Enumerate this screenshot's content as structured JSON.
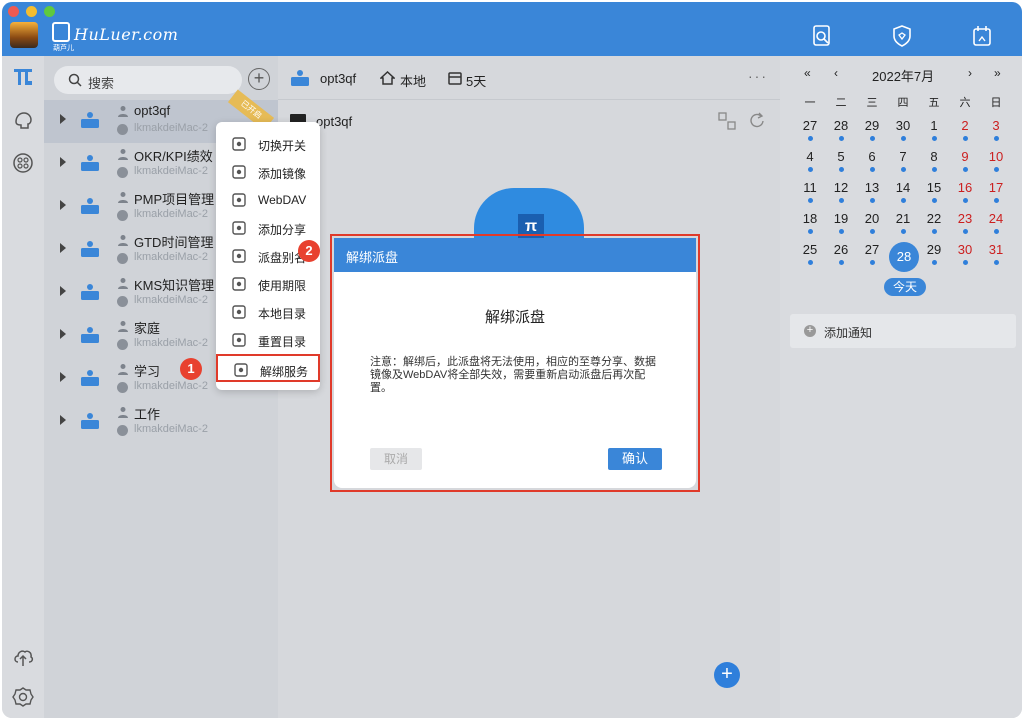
{
  "brand": {
    "logo_text": "HuLuer.com",
    "logo_sub": "葫芦儿"
  },
  "colors": {
    "accent": "#3a86d8",
    "highlight": "#e03a2a",
    "sidebar_bg": "#d0d3d8"
  },
  "sidebar": {
    "search_label": "搜索",
    "add_icon": "plus-circle-icon",
    "items": [
      {
        "name": "opt3qf",
        "host": "lkmakdeiMac-2",
        "selected": true,
        "ribbon": "已开启"
      },
      {
        "name": "OKR/KPI绩效",
        "host": "lkmakdeiMac-2"
      },
      {
        "name": "PMP项目管理",
        "host": "lkmakdeiMac-2"
      },
      {
        "name": "GTD时间管理",
        "host": "lkmakdeiMac-2"
      },
      {
        "name": "KMS知识管理",
        "host": "lkmakdeiMac-2"
      },
      {
        "name": "家庭",
        "host": "lkmakdeiMac-2"
      },
      {
        "name": "学习",
        "host": "lkmakdeiMac-2"
      },
      {
        "name": "工作",
        "host": "lkmakdeiMac-2"
      }
    ]
  },
  "main": {
    "disk_name": "opt3qf",
    "location": "本地",
    "days": "5天",
    "more": "···",
    "folder": "opt3qf"
  },
  "context_menu": {
    "items": [
      {
        "label": "切换开关",
        "icon": "toggle-icon"
      },
      {
        "label": "添加镜像",
        "icon": "database-icon"
      },
      {
        "label": "WebDAV",
        "icon": "user-icon"
      },
      {
        "label": "添加分享",
        "icon": "share-icon"
      },
      {
        "label": "派盘别名",
        "icon": "tag-icon"
      },
      {
        "label": "使用期限",
        "icon": "calendar-icon"
      },
      {
        "label": "本地目录",
        "icon": "monitor-icon"
      },
      {
        "label": "重置目录",
        "icon": "refresh-folder-icon"
      },
      {
        "label": "解绑服务",
        "icon": "unlink-icon",
        "highlighted": true
      }
    ]
  },
  "badges": {
    "one": "1",
    "two": "2"
  },
  "dialog": {
    "header": "解绑派盘",
    "title": "解绑派盘",
    "message": "注意：解绑后，此派盘将无法使用，相应的至尊分享、数据镜像及WebDAV将全部失效，需要重新启动派盘后再次配置。",
    "cancel": "取消",
    "confirm": "确认"
  },
  "calendar": {
    "prev_year": "«",
    "prev_month": "‹",
    "month_title": "2022年7月",
    "next_month": "›",
    "next_year": "»",
    "weekdays": [
      "一",
      "二",
      "三",
      "四",
      "五",
      "六",
      "日"
    ],
    "rows": [
      [
        "27",
        "28",
        "29",
        "30",
        "1",
        "2",
        "3"
      ],
      [
        "4",
        "5",
        "6",
        "7",
        "8",
        "9",
        "10"
      ],
      [
        "11",
        "12",
        "13",
        "14",
        "15",
        "16",
        "17"
      ],
      [
        "18",
        "19",
        "20",
        "21",
        "22",
        "23",
        "24"
      ],
      [
        "25",
        "26",
        "27",
        "28",
        "29",
        "30",
        "31"
      ]
    ],
    "today": "28",
    "today_button": "今天",
    "add_notice": "添加通知"
  }
}
